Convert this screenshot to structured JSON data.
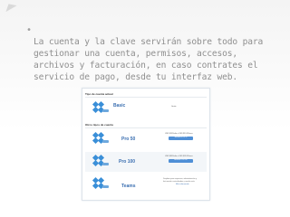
{
  "slide": {
    "bullet": "La cuenta y la clave servirán sobre todo para gestionar una  cuenta, permisos, accesos, archivos y facturación, en caso contrates el servicio de pago, desde tu interfaz web."
  },
  "screenshot": {
    "current_section_label": "Tipo de cuenta actual",
    "other_section_label": "Otros tipos de cuenta",
    "plans": [
      {
        "name": "Basic",
        "status": "Gratis"
      },
      {
        "name": "Pro 50",
        "price_line": "USD $199/año o USD $19.99/mes",
        "cta": "Actualizar a Pro 50"
      },
      {
        "name": "Pro 100",
        "price_line": "USD $399/año o USD $39.99/mes",
        "cta": "Actualizar a Pro 100"
      },
      {
        "name": "Teams",
        "note": "Dropbox para empresas, administración y",
        "note2": "facturación centralizadas y mucho más.",
        "link": "Más información"
      }
    ]
  },
  "colors": {
    "bullet_text": "#8f8f8f",
    "plan_name": "#3b6fb1",
    "button": "#4f8fd6",
    "dropbox_blue": "#3a8fd8"
  }
}
